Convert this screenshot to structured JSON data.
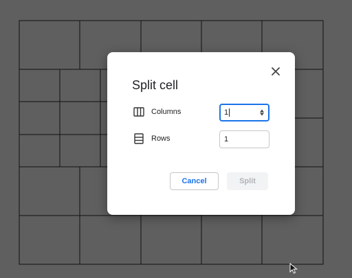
{
  "dialog": {
    "title": "Split cell",
    "columns_label": "Columns",
    "columns_value": "1",
    "rows_label": "Rows",
    "rows_value": "1",
    "cancel_label": "Cancel",
    "split_label": "Split"
  },
  "colors": {
    "accent": "#1a73e8",
    "backdrop": "#5f5f5f"
  },
  "icons": [
    "close-icon",
    "columns-icon",
    "rows-icon",
    "stepper-icon",
    "mouse-pointer-icon"
  ]
}
